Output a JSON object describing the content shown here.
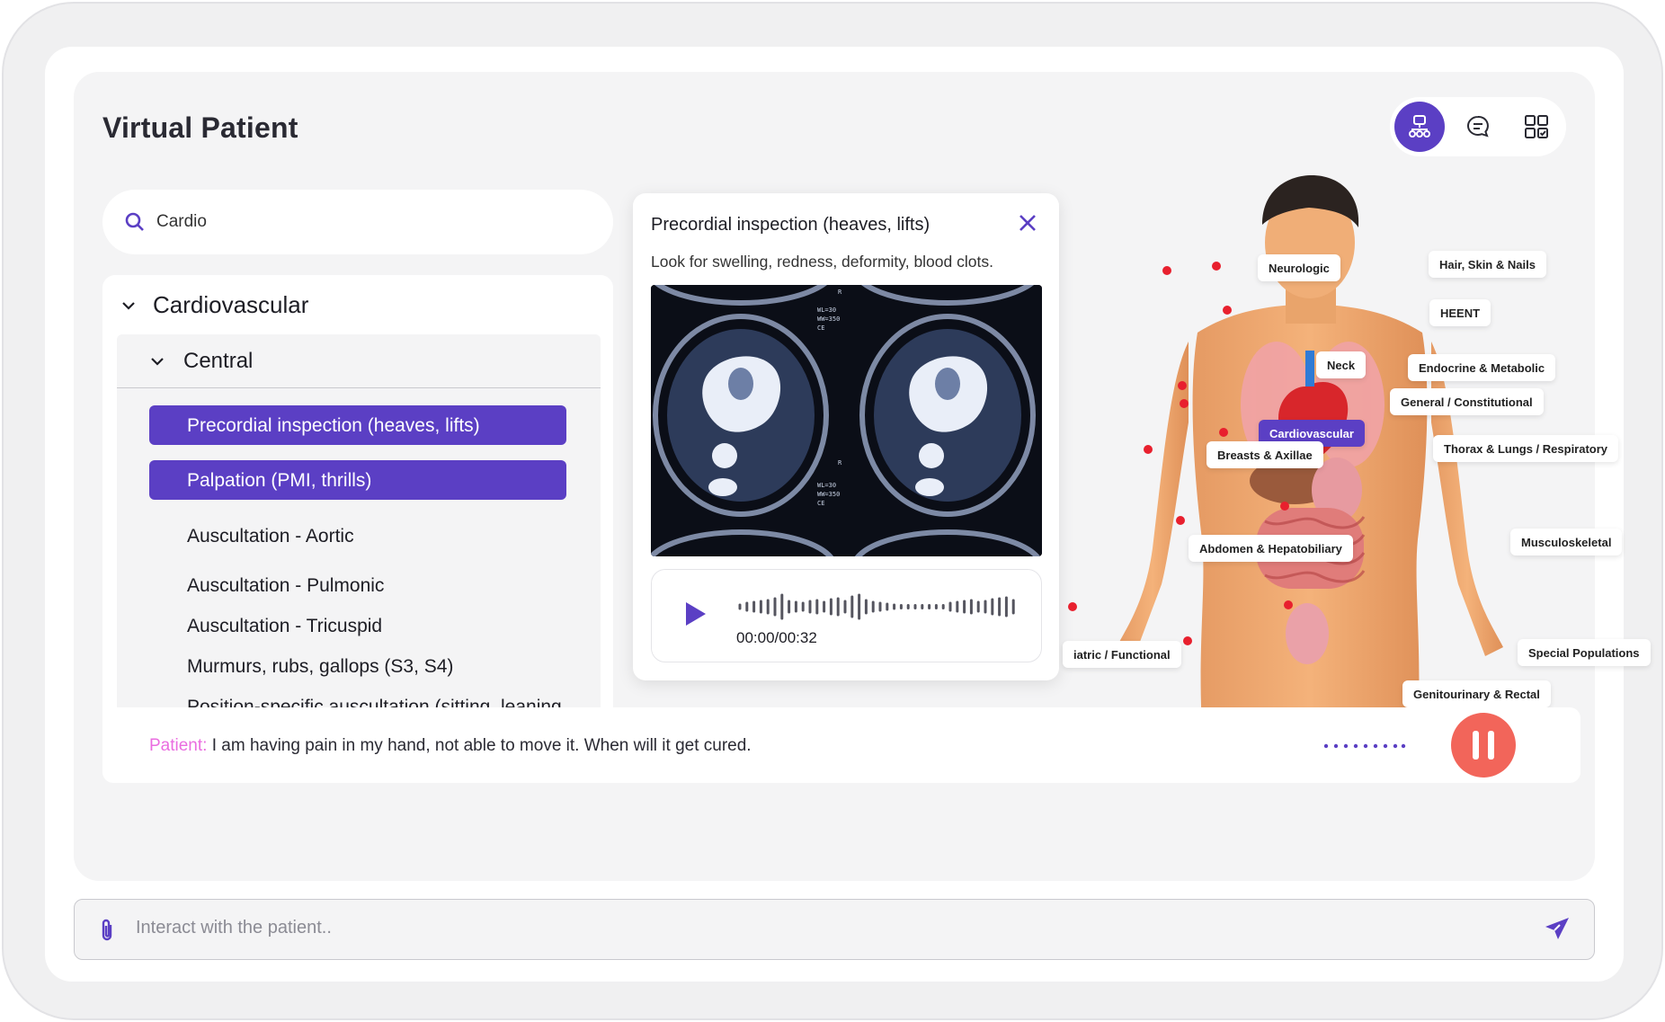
{
  "app": {
    "title": "Virtual Patient"
  },
  "view_toggle": [
    {
      "name": "body-map",
      "icon": "body-map-icon",
      "active": true
    },
    {
      "name": "chat",
      "icon": "chat-bubble-icon",
      "active": false
    },
    {
      "name": "grid",
      "icon": "grid-check-icon",
      "active": false
    }
  ],
  "search": {
    "value": "Cardio",
    "placeholder": "Search"
  },
  "tree": {
    "category": "Cardiovascular",
    "subcategory": "Central",
    "items": [
      {
        "label": "Precordial inspection (heaves, lifts)",
        "selected": true
      },
      {
        "label": "Palpation (PMI, thrills)",
        "selected": true
      },
      {
        "label": "Auscultation - Aortic",
        "selected": false
      },
      {
        "label": "Auscultation - Pulmonic",
        "selected": false
      },
      {
        "label": "Auscultation - Tricuspid",
        "selected": false
      },
      {
        "label": "Murmurs, rubs, gallops (S3, S4)",
        "selected": false
      },
      {
        "label": "Position-specific auscultation (sitting, leaning forward, left lateral)",
        "selected": false
      }
    ]
  },
  "detail": {
    "title": "Precordial inspection (heaves, lifts)",
    "description": "Look for swelling, redness, deformity, blood clots.",
    "image_alt": "chest CT scan",
    "audio": {
      "time": "00:00/00:32",
      "progress": 0
    }
  },
  "body_map": {
    "tags": [
      {
        "label": "Neurologic",
        "active": false
      },
      {
        "label": "Hair, Skin & Nails",
        "active": false
      },
      {
        "label": "HEENT",
        "active": false
      },
      {
        "label": "Neck",
        "active": false
      },
      {
        "label": "Endocrine & Metabolic",
        "active": false
      },
      {
        "label": "General / Constitutional",
        "active": false
      },
      {
        "label": "Cardiovascular",
        "active": true
      },
      {
        "label": "Thorax & Lungs / Respiratory",
        "active": false
      },
      {
        "label": "Breasts & Axillae",
        "active": false
      },
      {
        "label": "Musculoskeletal",
        "active": false
      },
      {
        "label": "Abdomen & Hepatobiliary",
        "active": false
      },
      {
        "label": "iatric / Functional",
        "active": false
      },
      {
        "label": "Special Populations",
        "active": false
      },
      {
        "label": "Genitourinary & Rectal",
        "active": false
      }
    ]
  },
  "conversation": {
    "speaker": "Patient:",
    "message": "I am having pain in my hand, not able to move it. When will it get cured."
  },
  "composer": {
    "placeholder": "Interact with the patient..",
    "value": ""
  },
  "colors": {
    "accent": "#5b3fc4",
    "patient": "#ea6de0",
    "pause": "#f2655a",
    "marker": "#e8202e"
  }
}
